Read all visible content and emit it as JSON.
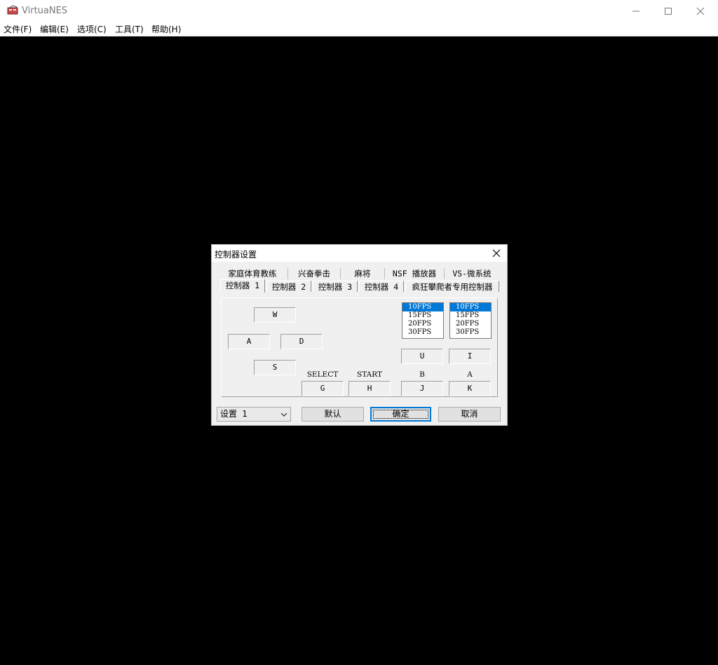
{
  "app": {
    "title": "VirtuaNES"
  },
  "menu": [
    "文件(F)",
    "编辑(E)",
    "选项(C)",
    "工具(T)",
    "帮助(H)"
  ],
  "dialog": {
    "title": "控制器设置",
    "tabs_row1": [
      "家庭体育教练",
      "兴奋拳击",
      "麻将",
      "NSF 播放器",
      "VS-微系统"
    ],
    "tabs_row2": [
      "控制器 1",
      "控制器 2",
      "控制器 3",
      "控制器 4",
      "疯狂攀爬者专用控制器"
    ],
    "active_tab": "控制器 1",
    "dpad": {
      "up": "W",
      "left": "A",
      "right": "D",
      "down": "S"
    },
    "select": {
      "label": "SELECT",
      "key": "G"
    },
    "start": {
      "label": "START",
      "key": "H"
    },
    "turbo_lists": [
      {
        "items": [
          "10FPS",
          "15FPS",
          "20FPS",
          "30FPS"
        ],
        "selected": "10FPS"
      },
      {
        "items": [
          "10FPS",
          "15FPS",
          "20FPS",
          "30FPS"
        ],
        "selected": "10FPS"
      }
    ],
    "turbo_keys": [
      "U",
      "I"
    ],
    "b": {
      "label": "B",
      "key": "J"
    },
    "a": {
      "label": "A",
      "key": "K"
    },
    "preset": "设置 1",
    "buttons": {
      "default": "默认",
      "ok": "确定",
      "cancel": "取消"
    }
  },
  "colors": {
    "selection": "#0078d7",
    "dialog_bg": "#f0f0f0",
    "canvas": "#000000"
  }
}
